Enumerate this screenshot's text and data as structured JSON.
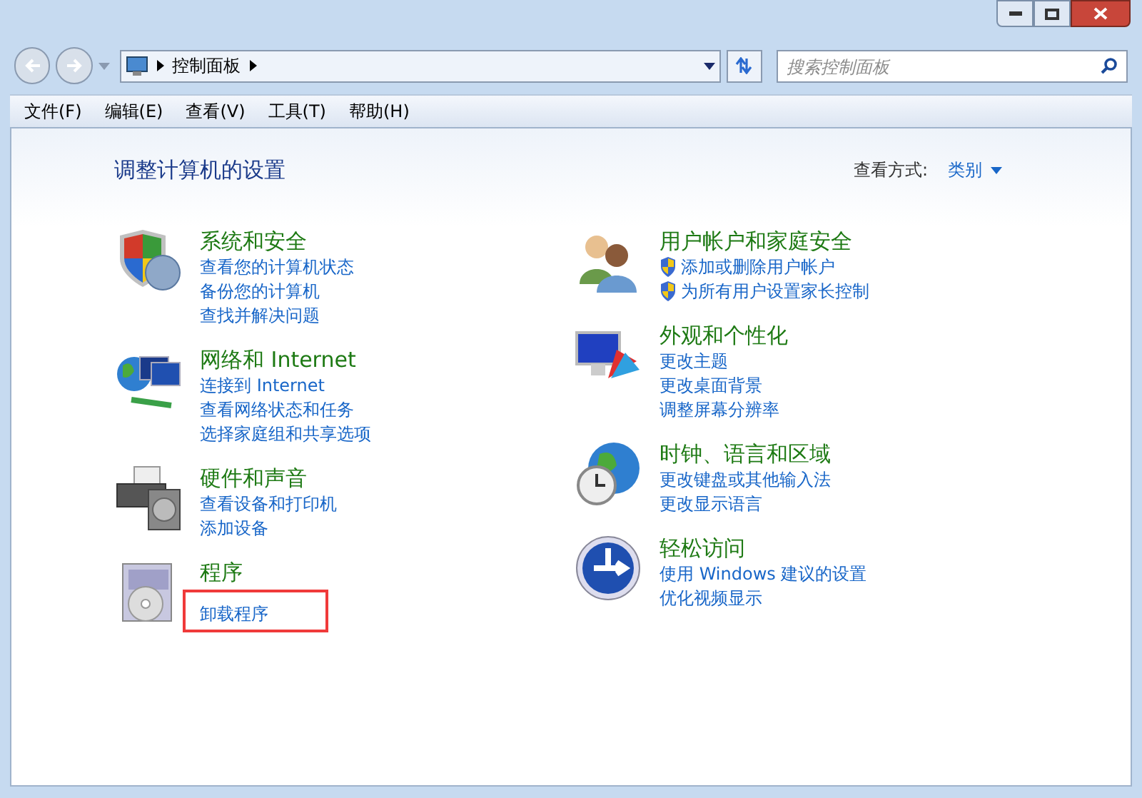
{
  "address_bar": {
    "crumbs": [
      "控制面板"
    ]
  },
  "search": {
    "placeholder": "搜索控制面板"
  },
  "menu_bar": [
    "文件(F)",
    "编辑(E)",
    "查看(V)",
    "工具(T)",
    "帮助(H)"
  ],
  "heading": "调整计算机的设置",
  "view_by": {
    "label": "查看方式:",
    "value": "类别"
  },
  "columns": [
    [
      {
        "kind": "security",
        "title": "系统和安全",
        "links": [
          {
            "text": "查看您的计算机状态",
            "admin": false,
            "highlighted": false
          },
          {
            "text": "备份您的计算机",
            "admin": false,
            "highlighted": false
          },
          {
            "text": "查找并解决问题",
            "admin": false,
            "highlighted": false
          }
        ]
      },
      {
        "kind": "network",
        "title": "网络和 Internet",
        "links": [
          {
            "text": "连接到 Internet",
            "admin": false,
            "highlighted": false
          },
          {
            "text": "查看网络状态和任务",
            "admin": false,
            "highlighted": false
          },
          {
            "text": "选择家庭组和共享选项",
            "admin": false,
            "highlighted": false
          }
        ]
      },
      {
        "kind": "hardware",
        "title": "硬件和声音",
        "links": [
          {
            "text": "查看设备和打印机",
            "admin": false,
            "highlighted": false
          },
          {
            "text": "添加设备",
            "admin": false,
            "highlighted": false
          }
        ]
      },
      {
        "kind": "programs",
        "title": "程序",
        "links": [
          {
            "text": "卸载程序",
            "admin": false,
            "highlighted": true
          }
        ]
      }
    ],
    [
      {
        "kind": "users",
        "title": "用户帐户和家庭安全",
        "links": [
          {
            "text": "添加或删除用户帐户",
            "admin": true,
            "highlighted": false
          },
          {
            "text": "为所有用户设置家长控制",
            "admin": true,
            "highlighted": false
          }
        ]
      },
      {
        "kind": "appearance",
        "title": "外观和个性化",
        "links": [
          {
            "text": "更改主题",
            "admin": false,
            "highlighted": false
          },
          {
            "text": "更改桌面背景",
            "admin": false,
            "highlighted": false
          },
          {
            "text": "调整屏幕分辨率",
            "admin": false,
            "highlighted": false
          }
        ]
      },
      {
        "kind": "clock",
        "title": "时钟、语言和区域",
        "links": [
          {
            "text": "更改键盘或其他输入法",
            "admin": false,
            "highlighted": false
          },
          {
            "text": "更改显示语言",
            "admin": false,
            "highlighted": false
          }
        ]
      },
      {
        "kind": "access",
        "title": "轻松访问",
        "links": [
          {
            "text": "使用 Windows 建议的设置",
            "admin": false,
            "highlighted": false
          },
          {
            "text": "优化视频显示",
            "admin": false,
            "highlighted": false
          }
        ]
      }
    ]
  ]
}
